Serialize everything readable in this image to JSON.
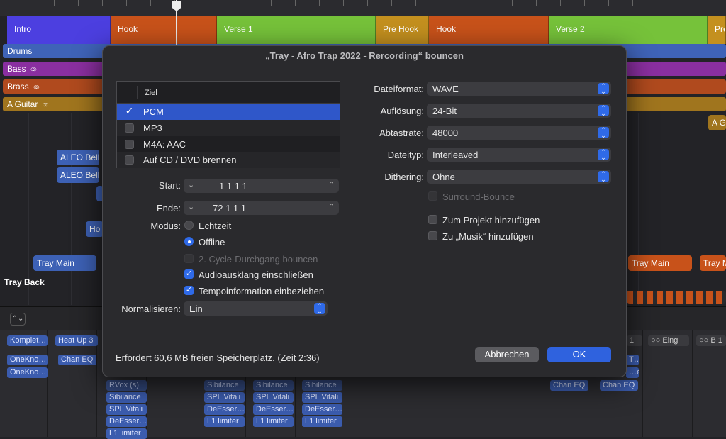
{
  "markers": [
    {
      "label": "Intro",
      "color": "#4c3fe0"
    },
    {
      "label": "Hook",
      "color": "#c8521a"
    },
    {
      "label": "Verse 1",
      "color": "#76c23a"
    },
    {
      "label": "Pre Hook",
      "color": "#c4901f"
    },
    {
      "label": "Hook",
      "color": "#c8521a"
    },
    {
      "label": "Verse 2",
      "color": "#76c23a"
    },
    {
      "label": "Pre",
      "color": "#c4901f"
    }
  ],
  "tracks": [
    {
      "label": "Drums",
      "color": "#3f63b8"
    },
    {
      "label": "Bass",
      "color": "#8a2fa0"
    },
    {
      "label": "Brass",
      "color": "#b04a1e"
    },
    {
      "label": "A Guitar",
      "color": "#a0751e"
    }
  ],
  "regions": {
    "aleo1": "ALEO Bell",
    "aleo2": "ALEO Bell",
    "ho": "Ho",
    "tray_main_left": "Tray Main",
    "tray_main_right1": "Tray Main",
    "tray_main_right2": "Tray M",
    "a_g": "A G",
    "tray_back": "Tray Back"
  },
  "mixer": {
    "dropdown": "⌃⌄",
    "top_right_labels": {
      "one": "1",
      "eing": "Eing",
      "b1": "B 1"
    },
    "plugins": {
      "komplet": "Komplet…",
      "heatup": "Heat Up 3",
      "oneknob1": "OneKno…",
      "oneknob2": "OneKno…",
      "chaneq1": "Chan EQ",
      "rvox": "RVox (s)",
      "sibilance": "Sibilance",
      "splvitali": "SPL Vitali",
      "deesser": "DeEsser…",
      "l1": "L1 limiter",
      "chaneq2": "Chan EQ",
      "chaneq3": "Chan EQ",
      "t_label": "T…",
      "e_label": "…e…"
    }
  },
  "dialog": {
    "title": "„Tray - Afro Trap 2022 - Rercording“ bouncen",
    "table_header": "Ziel",
    "destinations": [
      {
        "label": "PCM",
        "checked": true,
        "selected": true
      },
      {
        "label": "MP3",
        "checked": false,
        "selected": false
      },
      {
        "label": "M4A: AAC",
        "checked": false,
        "selected": false
      },
      {
        "label": "Auf CD / DVD brennen",
        "checked": false,
        "selected": false
      }
    ],
    "start_label": "Start:",
    "start_value": "1  1  1       1",
    "end_label": "Ende:",
    "end_value": "72  1  1       1",
    "mode_label": "Modus:",
    "mode_realtime": "Echtzeit",
    "mode_offline": "Offline",
    "cycle_bounce": "2. Cycle-Durchgang bouncen",
    "audio_tail": "Audioausklang einschließen",
    "tempo_info": "Tempoinformation einbeziehen",
    "normalize_label": "Normalisieren:",
    "normalize_value": "Ein",
    "format_label": "Dateiformat:",
    "format_value": "WAVE",
    "resolution_label": "Auflösung:",
    "resolution_value": "24-Bit",
    "samplerate_label": "Abtastrate:",
    "samplerate_value": "48000",
    "filetype_label": "Dateityp:",
    "filetype_value": "Interleaved",
    "dither_label": "Dithering:",
    "dither_value": "Ohne",
    "surround": "Surround-Bounce",
    "add_project": "Zum Projekt hinzufügen",
    "add_music": "Zu „Musik“ hinzufügen",
    "footer": "Erfordert 60,6 MB freien Speicherplatz. (Zeit 2:36)",
    "cancel": "Abbrechen",
    "ok": "OK"
  }
}
